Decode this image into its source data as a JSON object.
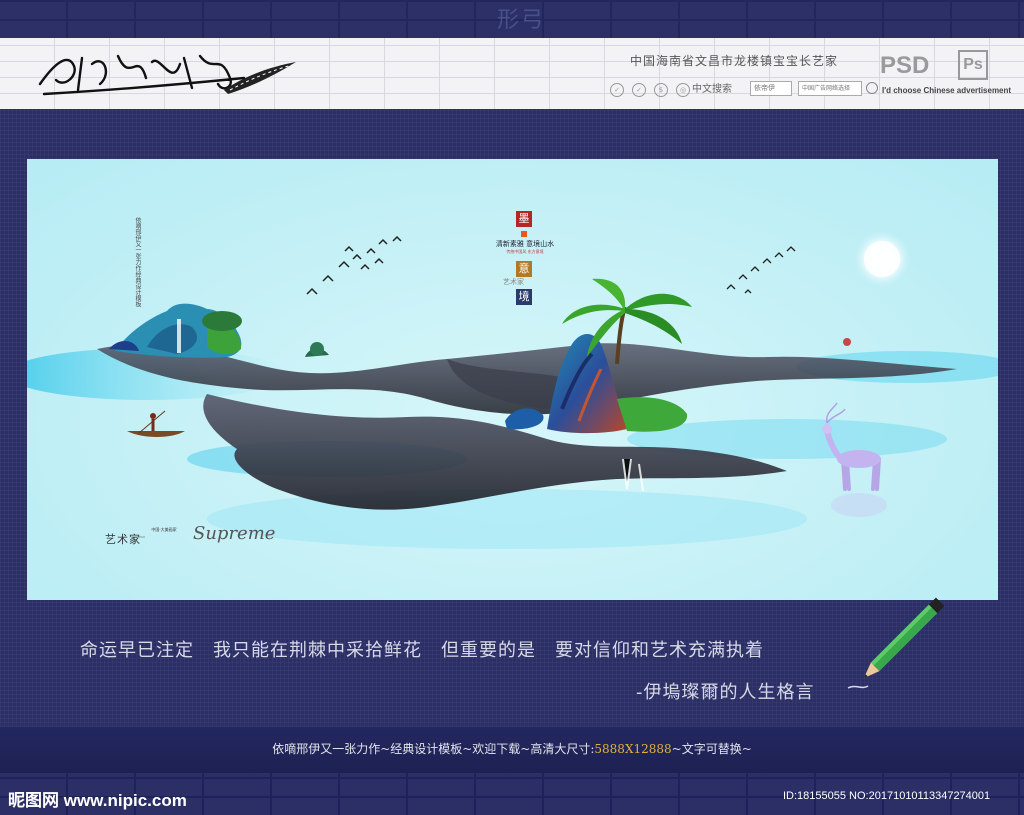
{
  "header": {
    "site_line": "中国海南省文昌市龙楼镇宝宝长艺家",
    "psd_label": "PSD",
    "ps_badge": "Ps",
    "search_label": "中文搜索",
    "search_field_1": "依帝伊",
    "search_field_2": "中国广告网络选择",
    "tagline": "I'd choose Chinese advertisement"
  },
  "top_watermark": "形弓",
  "poster": {
    "vertical_poem": "依嘀邢伊又一张力作经典设计模板",
    "seals": [
      "墨",
      "意",
      "境"
    ],
    "center_title": "清新素雅 意境山水",
    "center_sub": "传统中国风 东方意境",
    "center_art": "艺术家",
    "brand_artist": "艺术家",
    "brand_mini": "中国·大美画家",
    "brand_script": "Supreme",
    "colors": {
      "sky": "#c4f0f6",
      "ink": "#2a2a30",
      "rock_teal": "#2a9ab8",
      "tree_green": "#3aa03a",
      "deer": "#b6a6e8"
    }
  },
  "motto": "命运早已注定　我只能在荆棘中采拾鲜花　但重要的是　要对信仰和艺术充满执着",
  "motto_author": "-伊塢璨爾的人生格言",
  "promo": {
    "before": "依嘀邢伊又一张力作~经典设计模板~欢迎下载~高清大尺寸:",
    "size": "5888X12888",
    "after": "~文字可替换~"
  },
  "footer": {
    "site_logo": "昵图网 www.nipic.com",
    "image_id": "ID:18155055 NO:20171010113347274001"
  }
}
